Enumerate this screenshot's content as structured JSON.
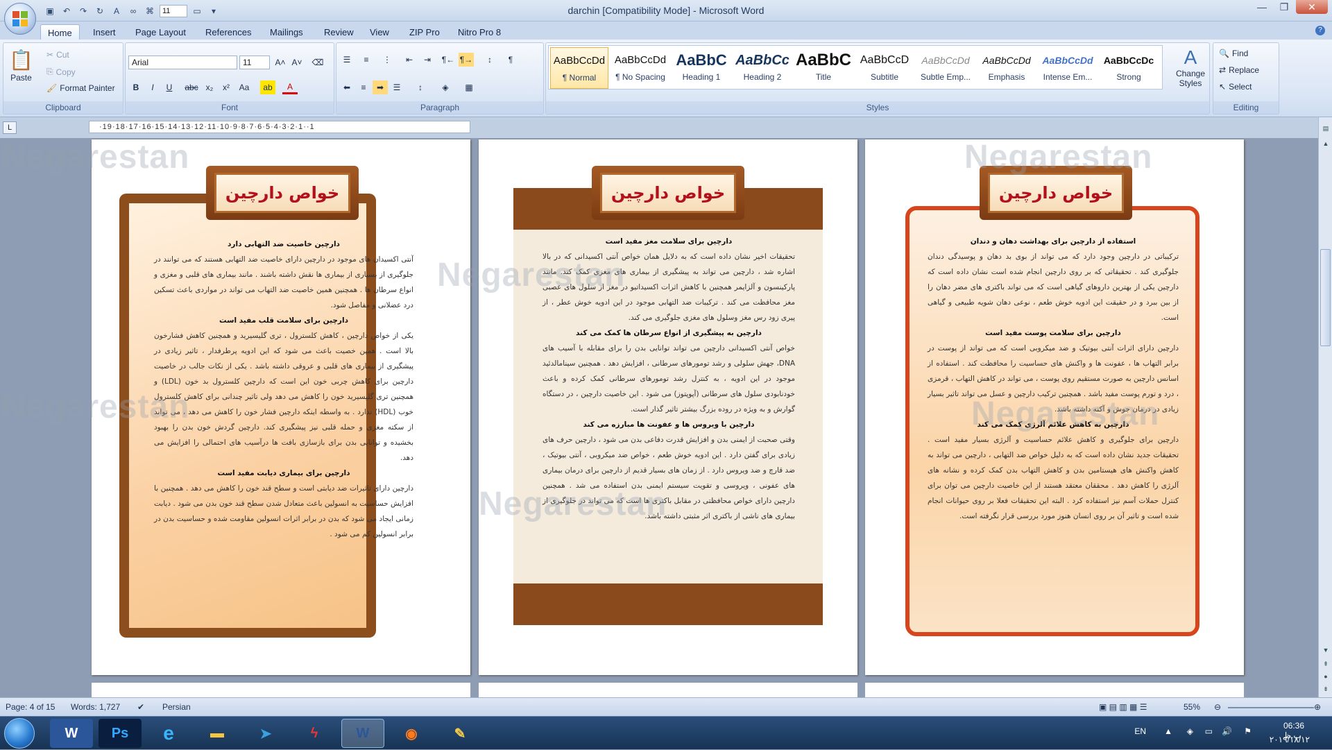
{
  "window": {
    "title": "darchin [Compatibility Mode] - Microsoft Word",
    "font_size_qat": "11"
  },
  "tabs": [
    "Home",
    "Insert",
    "Page Layout",
    "References",
    "Mailings",
    "Review",
    "View",
    "ZIP Pro",
    "Nitro Pro 8"
  ],
  "clipboard": {
    "paste": "Paste",
    "cut": "Cut",
    "copy": "Copy",
    "format_painter": "Format Painter",
    "label": "Clipboard"
  },
  "font": {
    "name": "Arial",
    "size": "11",
    "label": "Font"
  },
  "paragraph": {
    "label": "Paragraph"
  },
  "styles": {
    "label": "Styles",
    "change_styles": "Change Styles",
    "items": [
      {
        "preview": "AaBbCcDd",
        "name": "¶ Normal"
      },
      {
        "preview": "AaBbCcDd",
        "name": "¶ No Spacing"
      },
      {
        "preview": "AaBbC",
        "name": "Heading 1"
      },
      {
        "preview": "AaBbCc",
        "name": "Heading 2"
      },
      {
        "preview": "AaBbC",
        "name": "Title"
      },
      {
        "preview": "AaBbCcD",
        "name": "Subtitle"
      },
      {
        "preview": "AaBbCcDd",
        "name": "Subtle Emp..."
      },
      {
        "preview": "AaBbCcDd",
        "name": "Emphasis"
      },
      {
        "preview": "AaBbCcDd",
        "name": "Intense Em..."
      },
      {
        "preview": "AaBbCcDc",
        "name": "Strong"
      }
    ]
  },
  "editing": {
    "find": "Find",
    "replace": "Replace",
    "select": "Select",
    "label": "Editing"
  },
  "ruler": "·19·18·17·16·15·14·13·12·11·10·9·8·7·6·5·4·3·2·1··1",
  "watermark": "Negarestan",
  "pages": [
    {
      "title": "خواص دارچین",
      "blocks": [
        {
          "h": "دارچین خاصیت ضد التهابی دارد",
          "p": "آنتی اکسیدان های موجود در دارچین دارای خاصیت ضد التهابی هستند که می توانند در جلوگیری از بسیاری از بیماری ها نقش داشته باشند . مانند بیماری های قلبی و مغزی و انواع سرطان ها . همچنین همین خاصیت ضد التهاب می تواند در مواردی باعث تسکین درد عضلانی و مفاصل شود."
        },
        {
          "h": "دارچین برای سلامت قلب مفید است",
          "p": "یکی از خواص دارچین ، کاهش کلسترول ، تری گلیسیرید و همچنین کاهش فشارخون بالا است . همین خصیت باعث می شود که این ادویه پرطرفدار ، تاثیر زیادی در پیشگیری از بیماری های قلبی و عروقی داشته باشد . یکی از نکات جالب در خاصیت دارچین برای کاهش چربی خون این است که دارچین کلسترول بد خون (LDL) و همچنین تری گلیسیرید خون را کاهش می دهد ولی تاثیر چندانی برای کاهش کلسترول خوب (HDL) ندارد . به واسطه اینکه دارچین فشار خون را کاهش می دهد ، می تواند از سکته مغزی و حمله قلبی نیز پیشگیری کند. دارچین گردش خون بدن را بهبود بخشیده و توانایی بدن برای بازسازی بافت ها درآسیب های احتمالی را افزایش می دهد."
        },
        {
          "h": "دارچین برای بیماری دیابت مفید است",
          "p": "دارچین دارای تاثیرات ضد دیابتی است و سطح قند خون را کاهش می دهد . همچنین با افزایش حساسیت به انسولین باعث متعادل شدن سطح قند خون بدن می شود . دیابت زمانی ایجاد می شود که بدن در برابر اثرات انسولین مقاومت شده و حساسیت بدن در برابر انسولین کم می شود ."
        }
      ]
    },
    {
      "title": "خواص دارچین",
      "blocks": [
        {
          "h": "دارچین برای سلامت مغز مفید است",
          "p": "تحقیقات اخیر نشان داده است که به دلایل همان خواص آنتی اکسیدانی که در بالا اشاره شد ، دارچین می تواند به پیشگیری از بیماری های مغزی کمک کند. مانند پارکینسون و آلزایمر همچنین با کاهش اثرات اکسیداتیو در مغز از سلول های عصبی مغز محافظت می کند . ترکیبات ضد التهابی موجود در این ادویه خوش عطر ، از پیری زود رس مغز وسلول های مغزی جلوگیری می کند."
        },
        {
          "h": "دارچین به پیشگیری از انواع سرطان ها کمک می کند",
          "p": "خواص آنتی اکسیدانی دارچین می تواند توانایی بدن را برای مقابله با آسیب های DNA، جهش سلولی و رشد تومورهای سرطانی ، افزایش دهد . همچنین سینامالدئید موجود در این ادویه ، به کنترل رشد تومورهای سرطانی کمک کرده و باعث خودنابودی سلول های سرطانی (آپوپتوز) می شود . این خاصیت دارچین ، در دستگاه گوارش و به ویژه در روده بزرگ بیشتر تاثیر گذار است."
        },
        {
          "h": "دارچین با ویروس ها و عفونت ها مبارزه می کند",
          "p": "وقتی صحبت از ایمنی بدن و افزایش قدرت دفاعی بدن می شود ، دارچین حرف های زیادی برای گفتن دارد . این ادویه خوش طعم ، خواص ضد میکروبی ، آنتی بیوتیک ، ضد قارچ و ضد ویروس دارد . از زمان های بسیار قدیم از دارچین برای درمان بیماری های عفونی ، ویروسی و تقویت سیستم ایمنی بدن استفاده می شد . همچنین دارچین دارای خواص محافظتی در مقابل باکتری ها است که می تواند در جلوگیری از بیماری های ناشی از باکتری اثر مثبتی داشته باشد."
        }
      ]
    },
    {
      "title": "خواص دارچین",
      "blocks": [
        {
          "h": "استفاده از دارچین برای بهداشت دهان و دندان",
          "p": "ترکیباتی در دارچین وجود دارد که می تواند از بوی بد دهان و پوسیدگی دندان جلوگیری کند . تحقیقاتی که بر روی دارچین انجام شده است نشان داده است که دارچین یکی از بهترین داروهای گیاهی است که می تواند باکتری های مضر دهان را از بین ببرد و در حقیقت این ادویه خوش طعم ، نوعی دهان شویه طبیعی و گیاهی است."
        },
        {
          "h": "دارچین برای سلامت پوست مفید است",
          "p": "دارچین دارای اثرات آنتی بیوتیک و ضد میکروبی است که می تواند از پوست در برابر التهاب ها ، عفونت ها و واکنش های حساسیت را محافظت کند . استفاده از اسانس دارچین به صورت مستقیم روی پوست ، می تواند در کاهش التهاب ، قرمزی ، درد و تورم پوست مفید باشد . همچنین ترکیب دارچین و عسل می تواند تاثیر بسیار زیادی در درمان جوش و آکنه داشته باشد."
        },
        {
          "h": "دارچین به کاهش علائم آلرژی کمک می کند",
          "p": "دارچین برای جلوگیری و کاهش علائم حساسیت و آلرژی بسیار مفید است . تحقیقات جدید نشان داده است که به دلیل خواص ضد التهابی ، دارچین می تواند به کاهش واکنش های هیستامین بدن و کاهش التهاب بدن کمک کرده و نشانه های آلرژی را کاهش دهد . محققان معتقد هستند از این خاصیت دارچین می توان برای کنترل حملات آسم نیز استفاده کرد . البته این تحقیقات فعلا بر روی حیوانات انجام شده است و تاثیر آن بر روی انسان هنوز مورد بررسی قرار نگرفته است."
        }
      ]
    }
  ],
  "status": {
    "page": "Page: 4 of 15",
    "words": "Words: 1,727",
    "language": "Persian",
    "zoom": "55%"
  },
  "tray": {
    "lang": "EN",
    "time": "06:36 ب.ظ",
    "date": "۲۰۱۹/۱۸/۱۲"
  }
}
